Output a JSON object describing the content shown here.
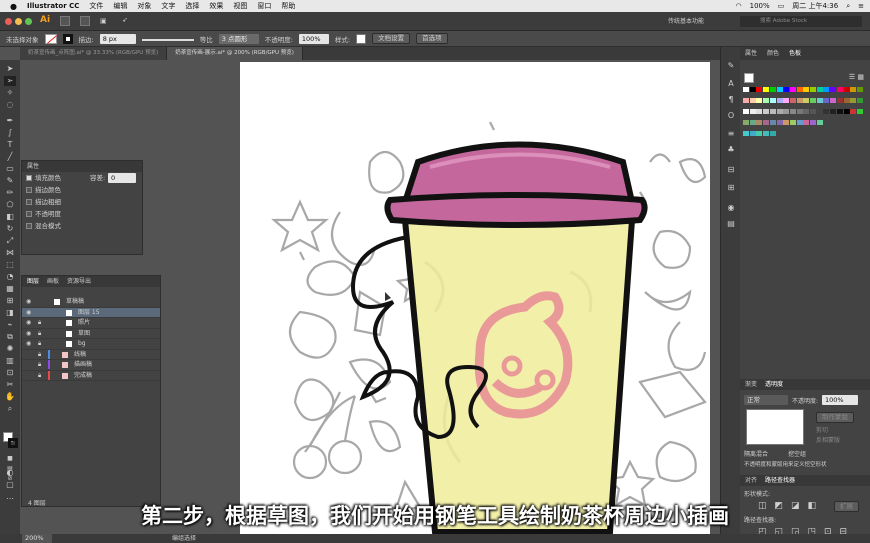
{
  "menubar": {
    "app": "Illustrator CC",
    "items": [
      "文件",
      "编辑",
      "对象",
      "文字",
      "选择",
      "效果",
      "视图",
      "窗口",
      "帮助"
    ],
    "battery": "100%",
    "clock": "周二 上午4:36"
  },
  "appbar": {
    "workspace": "传统基本功能",
    "search_placeholder": "搜索 Adobe Stock"
  },
  "control": {
    "selection": "未选择对象",
    "stroke_label": "描边:",
    "stroke_value": "8 px",
    "stroke_style": "等比",
    "brush": "3 点圆形",
    "opacity_label": "不透明度:",
    "opacity_value": "100%",
    "style_label": "样式:",
    "doc_setup": "文档设置",
    "prefs": "首选项"
  },
  "tabs": [
    {
      "label": "奶茶宣传画_点阵图.ai* @ 33.33% (RGB/GPU 预览)"
    },
    {
      "label": "奶茶宣传画-展示.ai* @ 200% (RGB/GPU 预览)"
    }
  ],
  "attributes": {
    "title": "属性",
    "fill_color": "填充颜色",
    "capacity": "容差:",
    "capacity_value": "0",
    "stroke_color": "描边颜色",
    "stroke_width": "描边粗细",
    "opacity": "不透明度",
    "blend": "混合模式"
  },
  "layers": {
    "tabs": [
      "图层",
      "画板",
      "资源导出"
    ],
    "rows": [
      {
        "name": "草稿稿"
      },
      {
        "name": "图层 15"
      },
      {
        "name": "照片"
      },
      {
        "name": "草图"
      },
      {
        "name": "bg"
      },
      {
        "name": "线稿"
      },
      {
        "name": "描画稿"
      },
      {
        "name": "完成稿"
      }
    ],
    "count": "4 图层"
  },
  "right_panel": {
    "tabs": [
      "属性",
      "颜色",
      "色板"
    ],
    "transparency_tabs": [
      "渐变",
      "透明度"
    ],
    "blend_mode": "正常",
    "opacity_label": "不透明度:",
    "opacity_value": "100%",
    "make_mask": "制作蒙版",
    "clip": "剪切",
    "invert_mask": "反相蒙版",
    "isolate": "隔离混合",
    "knockout": "挖空组",
    "opacity_mask": "不透明度和蒙版用来定义挖空形状",
    "pathfinder_tabs": [
      "对齐",
      "路径查找器"
    ],
    "shape_modes": "形状模式:",
    "expand": "扩展",
    "pathfinders": "路径查找器:"
  },
  "status": {
    "zoom": "200%",
    "mode": "编组选择"
  },
  "subtitle": "第二步，根据草图，我们开始用钢笔工具绘制奶茶杯周边小插画",
  "colors": {
    "cup": "#f1efa8",
    "lid": "#c4679c",
    "logo": "#e99a98"
  }
}
